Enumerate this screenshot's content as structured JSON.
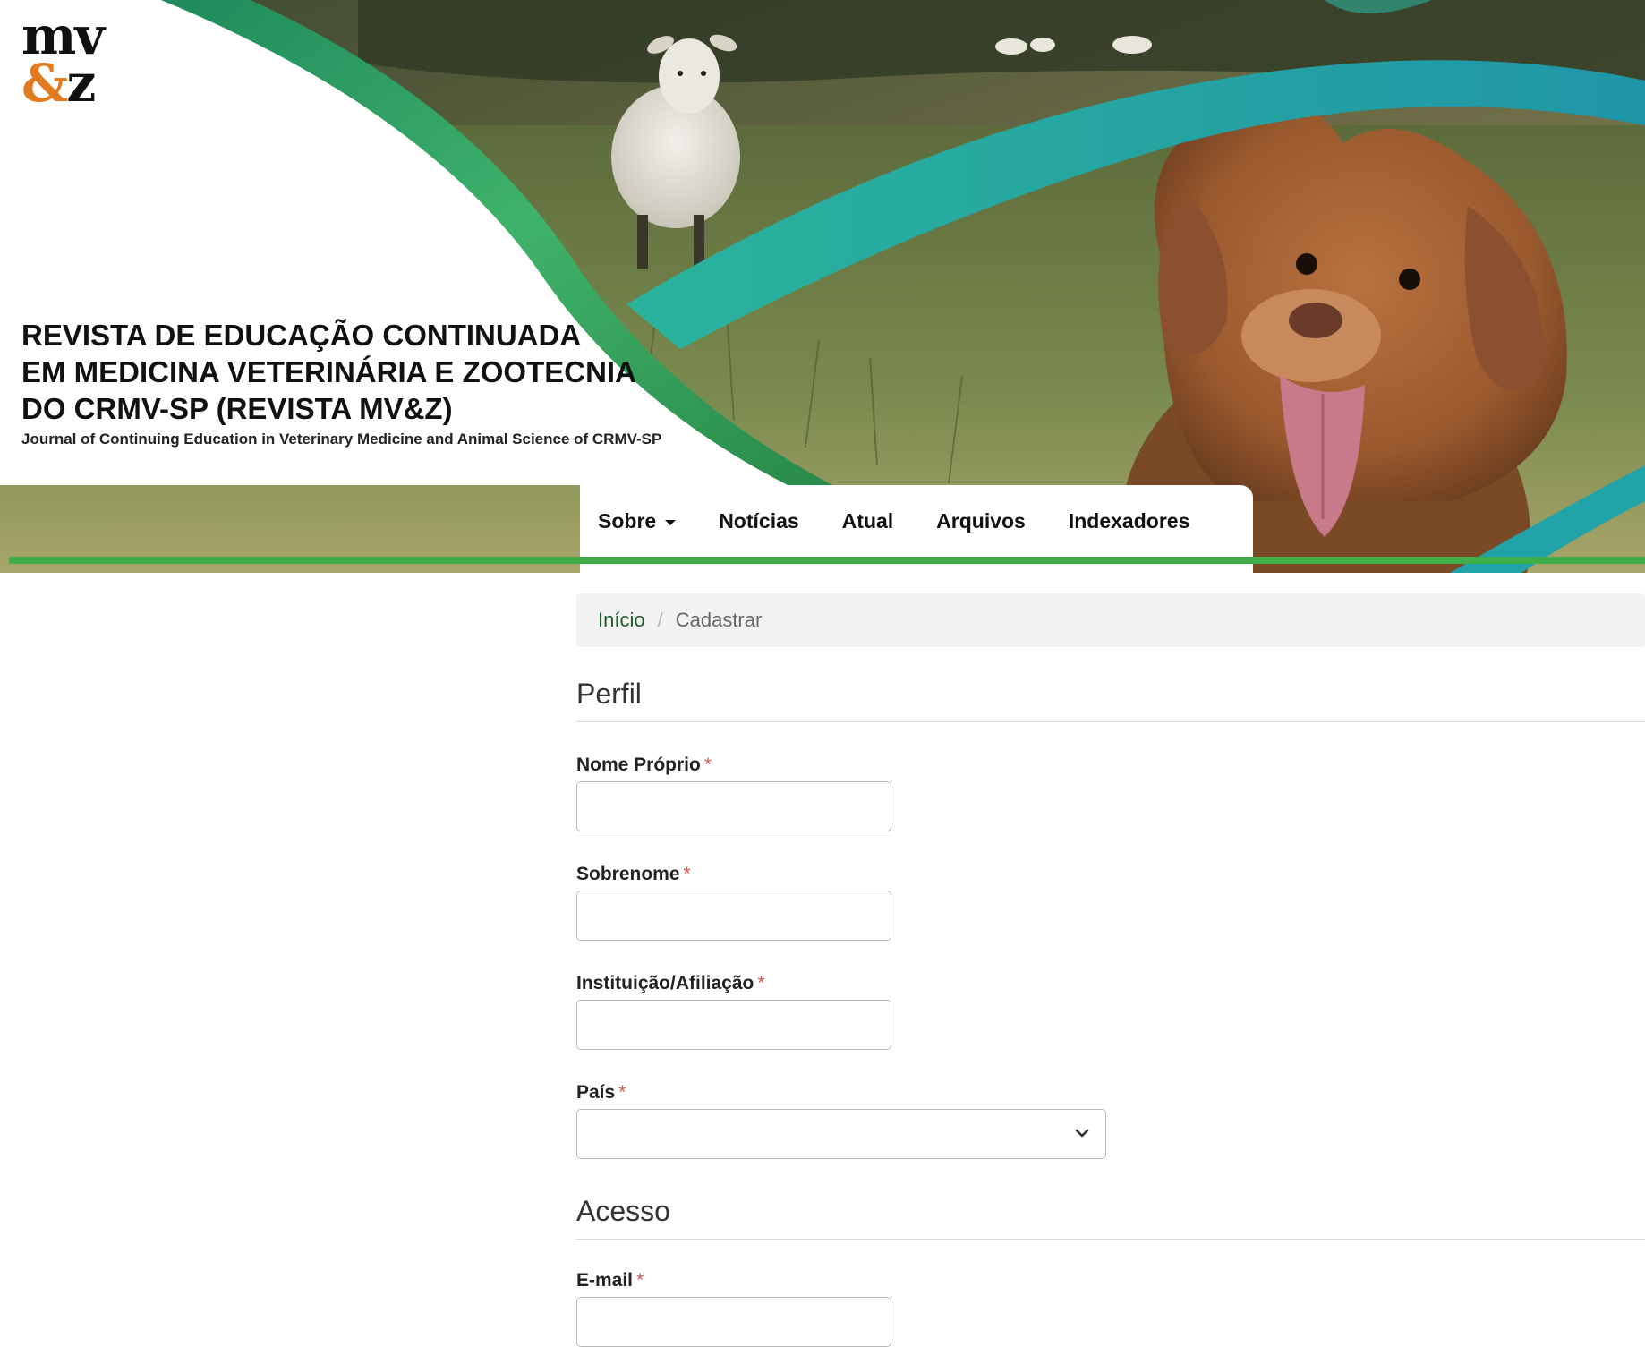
{
  "logo": {
    "top": "mv",
    "amp": "&",
    "z": "z"
  },
  "journal": {
    "title_lines": [
      "REVISTA DE EDUCAÇÃO CONTINUADA",
      "EM MEDICINA VETERINÁRIA E ZOOTECNIA",
      "DO CRMV-SP (REVISTA MV&Z)"
    ],
    "subtitle": "Journal of Continuing Education in Veterinary Medicine and Animal Science of CRMV-SP"
  },
  "nav": {
    "items": [
      {
        "label": "Sobre",
        "has_dropdown": true
      },
      {
        "label": "Notícias"
      },
      {
        "label": "Atual"
      },
      {
        "label": "Arquivos"
      },
      {
        "label": "Indexadores"
      }
    ]
  },
  "breadcrumb": {
    "home": "Início",
    "separator": "/",
    "current": "Cadastrar"
  },
  "form": {
    "profile_section": "Perfil",
    "access_section": "Acesso",
    "required_mark": "*",
    "fields": {
      "given_name": {
        "label": "Nome Próprio",
        "value": ""
      },
      "family_name": {
        "label": "Sobrenome",
        "value": ""
      },
      "affiliation": {
        "label": "Instituição/Afiliação",
        "value": ""
      },
      "country": {
        "label": "País",
        "selected": ""
      },
      "email": {
        "label": "E-mail",
        "value": ""
      }
    }
  },
  "colors": {
    "accent_green": "#3fae49",
    "logo_orange": "#e07b1f",
    "required_red": "#d9534f",
    "link_green": "#1a5c2a",
    "teal": "#22a3a8"
  },
  "icons": {
    "nav_dropdown": "caret-down-icon",
    "select_dropdown": "chevron-down-icon"
  }
}
